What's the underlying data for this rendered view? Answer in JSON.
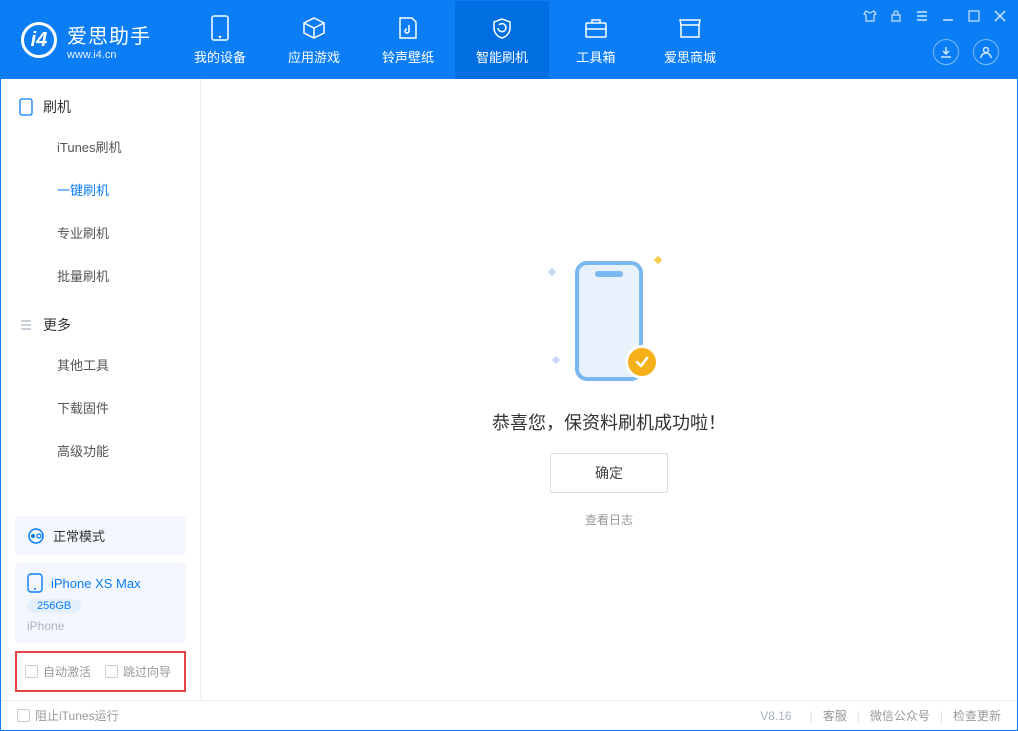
{
  "app": {
    "name": "爱思助手",
    "url": "www.i4.cn"
  },
  "tabs": [
    {
      "label": "我的设备"
    },
    {
      "label": "应用游戏"
    },
    {
      "label": "铃声壁纸"
    },
    {
      "label": "智能刷机"
    },
    {
      "label": "工具箱"
    },
    {
      "label": "爱思商城"
    }
  ],
  "sidebar": {
    "groupA": {
      "title": "刷机",
      "items": [
        "iTunes刷机",
        "一键刷机",
        "专业刷机",
        "批量刷机"
      ],
      "activeIndex": 1
    },
    "groupB": {
      "title": "更多",
      "items": [
        "其他工具",
        "下载固件",
        "高级功能"
      ]
    },
    "mode": "正常模式",
    "device": {
      "name": "iPhone XS Max",
      "storage": "256GB",
      "type": "iPhone"
    },
    "opts": {
      "autoActivate": "自动激活",
      "skipGuide": "跳过向导"
    }
  },
  "main": {
    "success": "恭喜您，保资料刷机成功啦！",
    "ok": "确定",
    "logLink": "查看日志"
  },
  "status": {
    "blockItunes": "阻止iTunes运行",
    "version": "V8.16",
    "links": [
      "客服",
      "微信公众号",
      "检查更新"
    ]
  }
}
